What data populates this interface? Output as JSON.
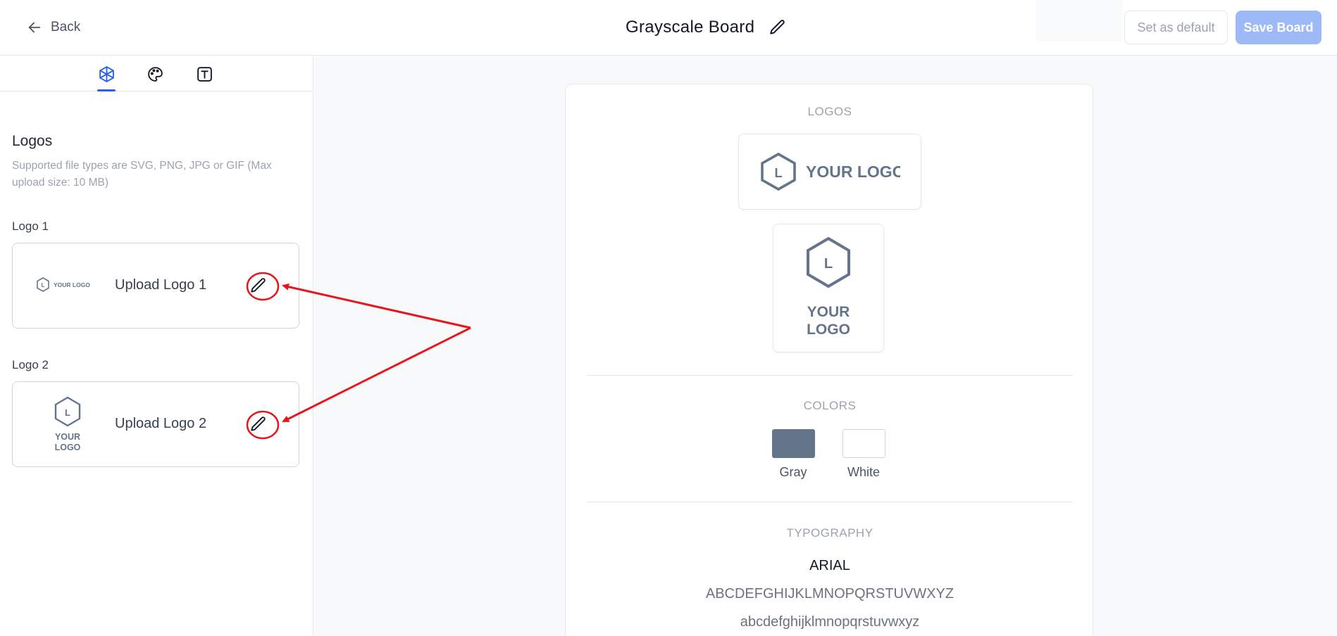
{
  "header": {
    "back_label": "Back",
    "board_title": "Grayscale Board",
    "set_default_label": "Set as default",
    "save_label": "Save Board"
  },
  "sidebar": {
    "tabs": [
      {
        "icon": "cube-icon",
        "active": true
      },
      {
        "icon": "palette-icon",
        "active": false
      },
      {
        "icon": "text-type-icon",
        "active": false
      }
    ],
    "section_title": "Logos",
    "section_desc": "Supported file types are SVG, PNG, JPG or GIF (Max upload size: 10 MB)",
    "logos": [
      {
        "label": "Logo 1",
        "upload_text": "Upload Logo 1",
        "thumb_text": "YOUR LOGO",
        "thumb_letter": "L"
      },
      {
        "label": "Logo 2",
        "upload_text": "Upload Logo 2",
        "thumb_text_line1": "YOUR",
        "thumb_text_line2": "LOGO",
        "thumb_letter": "L"
      }
    ]
  },
  "preview": {
    "logos_heading": "LOGOS",
    "logo_horizontal_text": "YOUR LOGO",
    "logo_vertical_line1": "YOUR",
    "logo_vertical_line2": "LOGO",
    "logo_letter": "L",
    "colors_heading": "COLORS",
    "colors": [
      {
        "name": "Gray",
        "hex": "#64748b"
      },
      {
        "name": "White",
        "hex": "#ffffff"
      }
    ],
    "typography_heading": "TYPOGRAPHY",
    "font_name": "ARIAL",
    "uppercase_sample": "ABCDEFGHIJKLMNOPQRSTUVWXYZ",
    "lowercase_sample": "abcdefghijklmnopqrstuvwxyz"
  },
  "theme": {
    "accent": "#2563eb",
    "save_button_bg": "#9db9f7",
    "annotation_red": "#e8161b",
    "logo_gray": "#64748b"
  }
}
